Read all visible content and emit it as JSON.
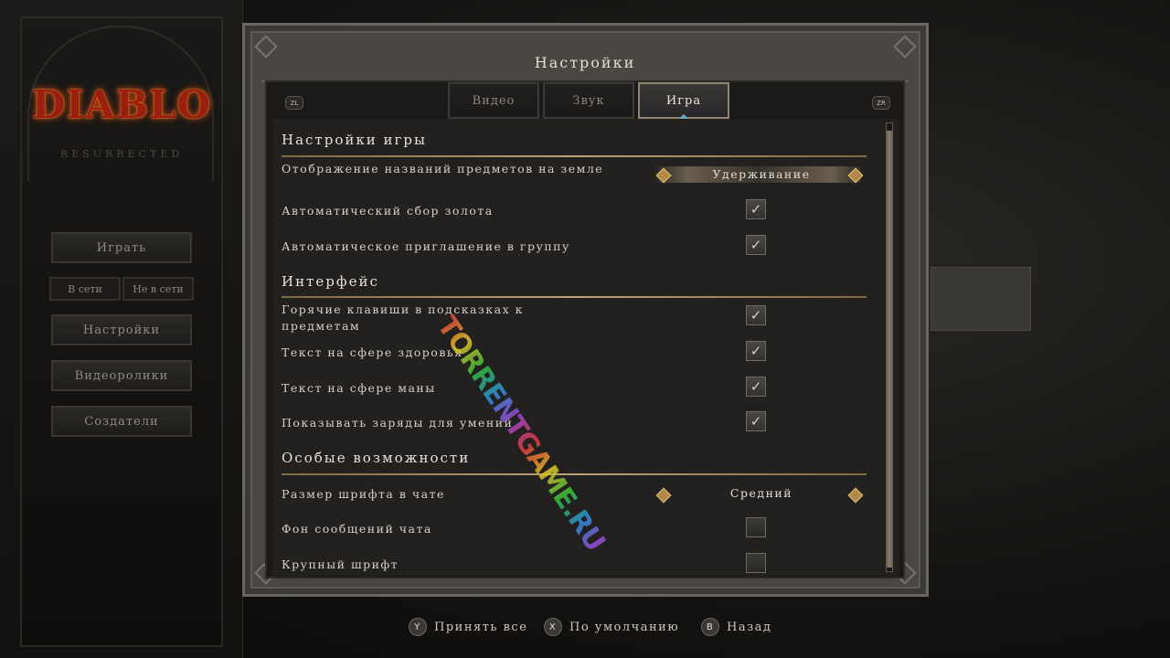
{
  "left_menu": {
    "logo_text": "DIABLO",
    "logo_sub": "RESURRECTED",
    "play_label": "Играть",
    "online_label": "В сети",
    "offline_label": "Не в сети",
    "settings_label": "Настройки",
    "videos_label": "Видеоролики",
    "credits_label": "Создатели"
  },
  "dialog": {
    "title": "Настройки",
    "zl_label": "ZL",
    "zr_label": "ZR",
    "tabs": [
      {
        "label": "Видео",
        "active": false
      },
      {
        "label": "Звук",
        "active": false
      },
      {
        "label": "Игра",
        "active": true
      }
    ]
  },
  "settings": {
    "game_section": "Настройки игры",
    "item_names_label": "Отображение названий предметов на земле",
    "item_names_value": "Удерживание",
    "auto_gold_label": "Автоматический сбор золота",
    "auto_gold_checked": true,
    "auto_party_label": "Автоматическое приглашение в группу",
    "auto_party_checked": true,
    "interface_section": "Интерфейс",
    "hotkeys_label": "Горячие клавиши в подсказках к предметам",
    "hotkeys_checked": true,
    "health_text_label": "Текст на сфере здоровья",
    "health_text_checked": true,
    "mana_text_label": "Текст на сфере маны",
    "mana_text_checked": true,
    "charges_label": "Показывать заряды для умений",
    "charges_checked": true,
    "accessibility_section": "Особые возможности",
    "chat_font_label": "Размер шрифта в чате",
    "chat_font_value": "Средний",
    "chat_bg_label": "Фон сообщений чата",
    "chat_bg_checked": false,
    "large_font_label": "Крупный шрифт",
    "large_font_checked": false
  },
  "prompts": {
    "accept_button": "Y",
    "accept_label": "Принять все",
    "default_button": "X",
    "default_label": "По умолчанию",
    "back_button": "B",
    "back_label": "Назад"
  },
  "watermark": "TORRENTGAME.RU",
  "colors": {
    "accent_gold": "#b9a274",
    "tab_active_border": "#8f8573",
    "logo_red": "#9a1f0e"
  }
}
